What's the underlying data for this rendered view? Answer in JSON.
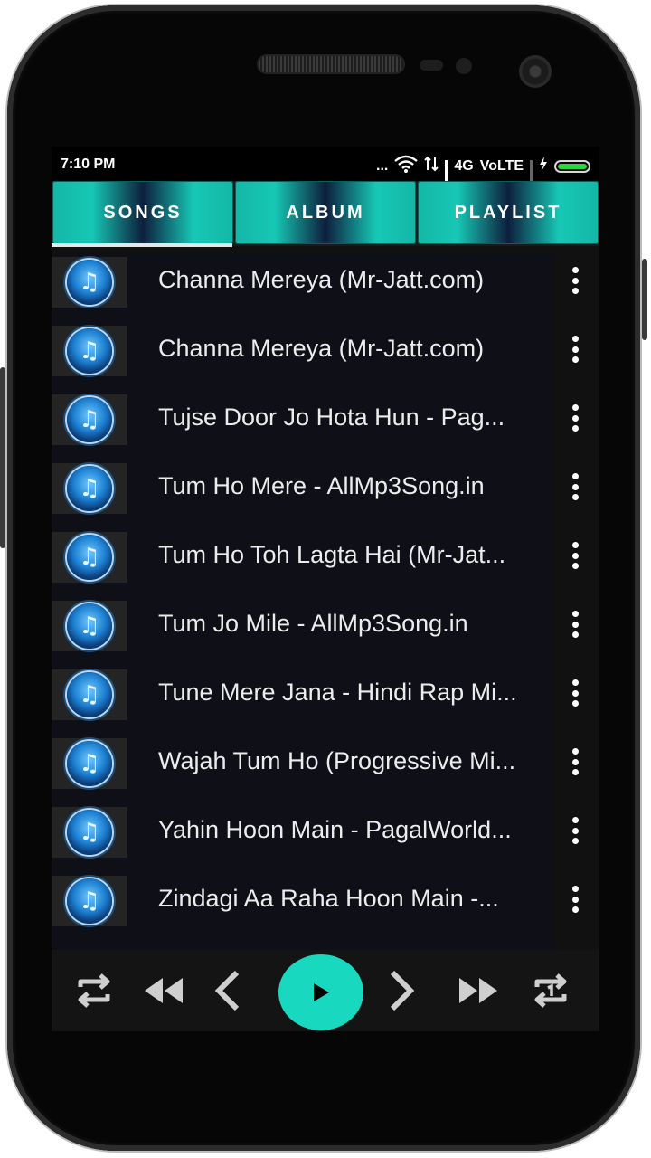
{
  "status_bar": {
    "time": "7:10 PM",
    "dots": "...",
    "network_type": "4G",
    "volte": "VoLTE"
  },
  "tabs": [
    {
      "label": "SONGS"
    },
    {
      "label": "ALBUM"
    },
    {
      "label": "PLAYLIST"
    }
  ],
  "songs": [
    {
      "title": "Channa Mereya (Mr-Jatt.com)"
    },
    {
      "title": "Channa Mereya (Mr-Jatt.com)"
    },
    {
      "title": "Tujse Door Jo Hota Hun - Pag..."
    },
    {
      "title": "Tum Ho Mere - AllMp3Song.in"
    },
    {
      "title": "Tum Ho Toh Lagta Hai (Mr-Jat..."
    },
    {
      "title": "Tum Jo Mile - AllMp3Song.in"
    },
    {
      "title": "Tune Mere Jana - Hindi Rap Mi..."
    },
    {
      "title": "Wajah Tum Ho (Progressive Mi..."
    },
    {
      "title": "Yahin Hoon Main - PagalWorld..."
    },
    {
      "title": "Zindagi Aa Raha Hoon Main -..."
    }
  ],
  "icons": {
    "song": "music-note-icon",
    "more": "more-vert-icon",
    "repeat": "repeat-icon",
    "rewind": "rewind-icon",
    "previous": "previous-icon",
    "play": "play-icon",
    "next": "next-icon",
    "fast_forward": "fast-forward-icon",
    "repeat_one": "repeat-one-icon"
  },
  "colors": {
    "accent": "#19d8c0",
    "tab_dark": "#0d1f3d",
    "battery": "#2cd63a"
  }
}
